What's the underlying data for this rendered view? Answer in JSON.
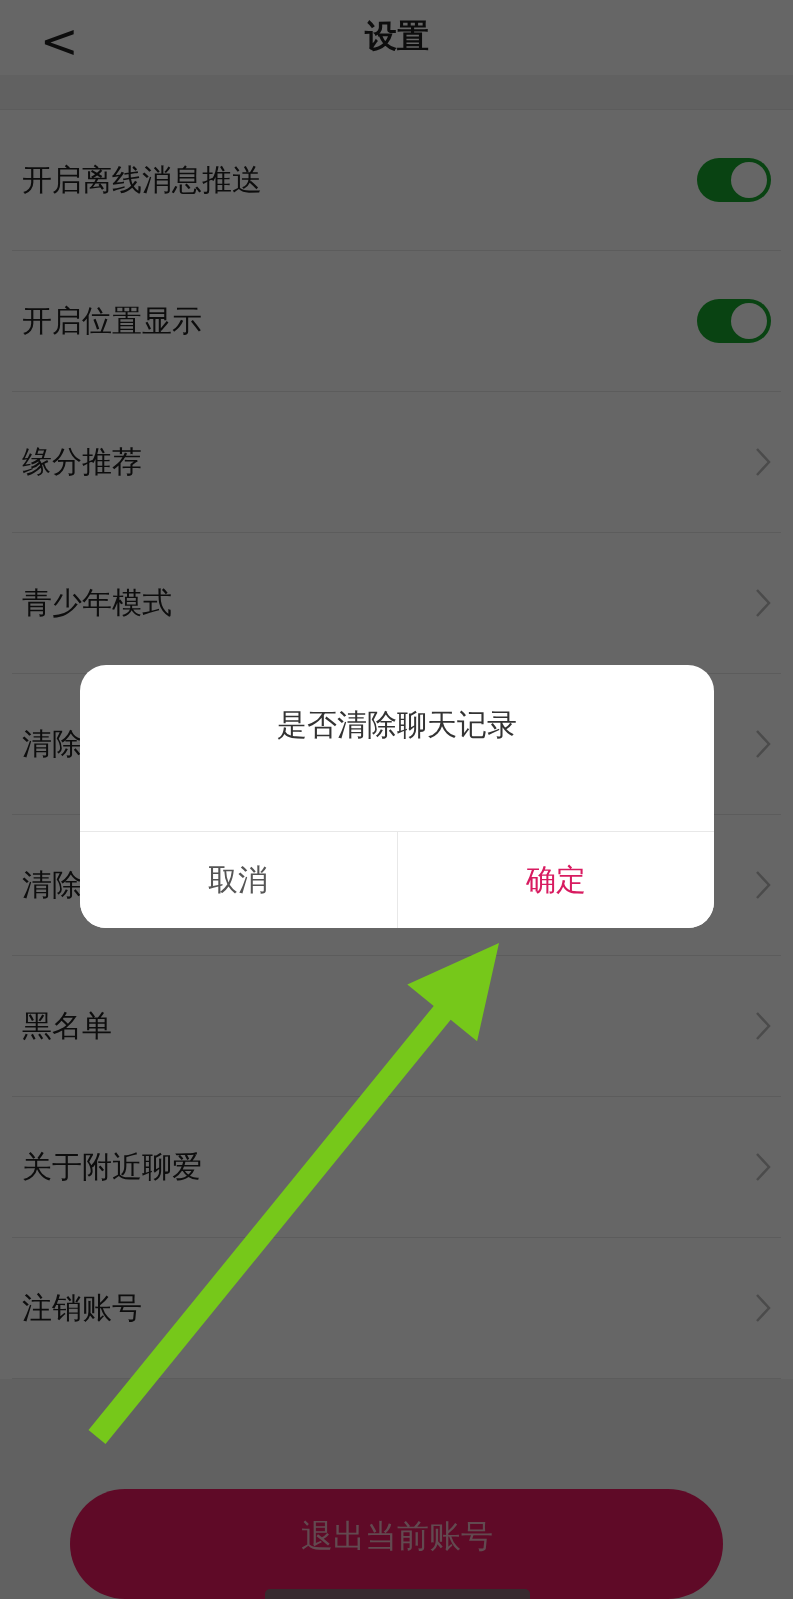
{
  "header": {
    "back": "<",
    "title": "设置"
  },
  "rows": [
    {
      "kind": "toggle",
      "label": "开启离线消息推送",
      "on": true
    },
    {
      "kind": "toggle",
      "label": "开启位置显示",
      "on": true
    },
    {
      "kind": "link",
      "label": "缘分推荐"
    },
    {
      "kind": "link",
      "label": "青少年模式"
    },
    {
      "kind": "link",
      "label": "清除"
    },
    {
      "kind": "link",
      "label": "清除"
    },
    {
      "kind": "link",
      "label": "黑名单"
    },
    {
      "kind": "link",
      "label": "关于附近聊爱"
    },
    {
      "kind": "link",
      "label": "注销账号"
    }
  ],
  "logout_button": "退出当前账号",
  "dialog": {
    "message": "是否清除聊天记录",
    "buttons": [
      {
        "label": "取消",
        "kind": "cancel"
      },
      {
        "label": "确定",
        "kind": "confirm"
      }
    ]
  }
}
